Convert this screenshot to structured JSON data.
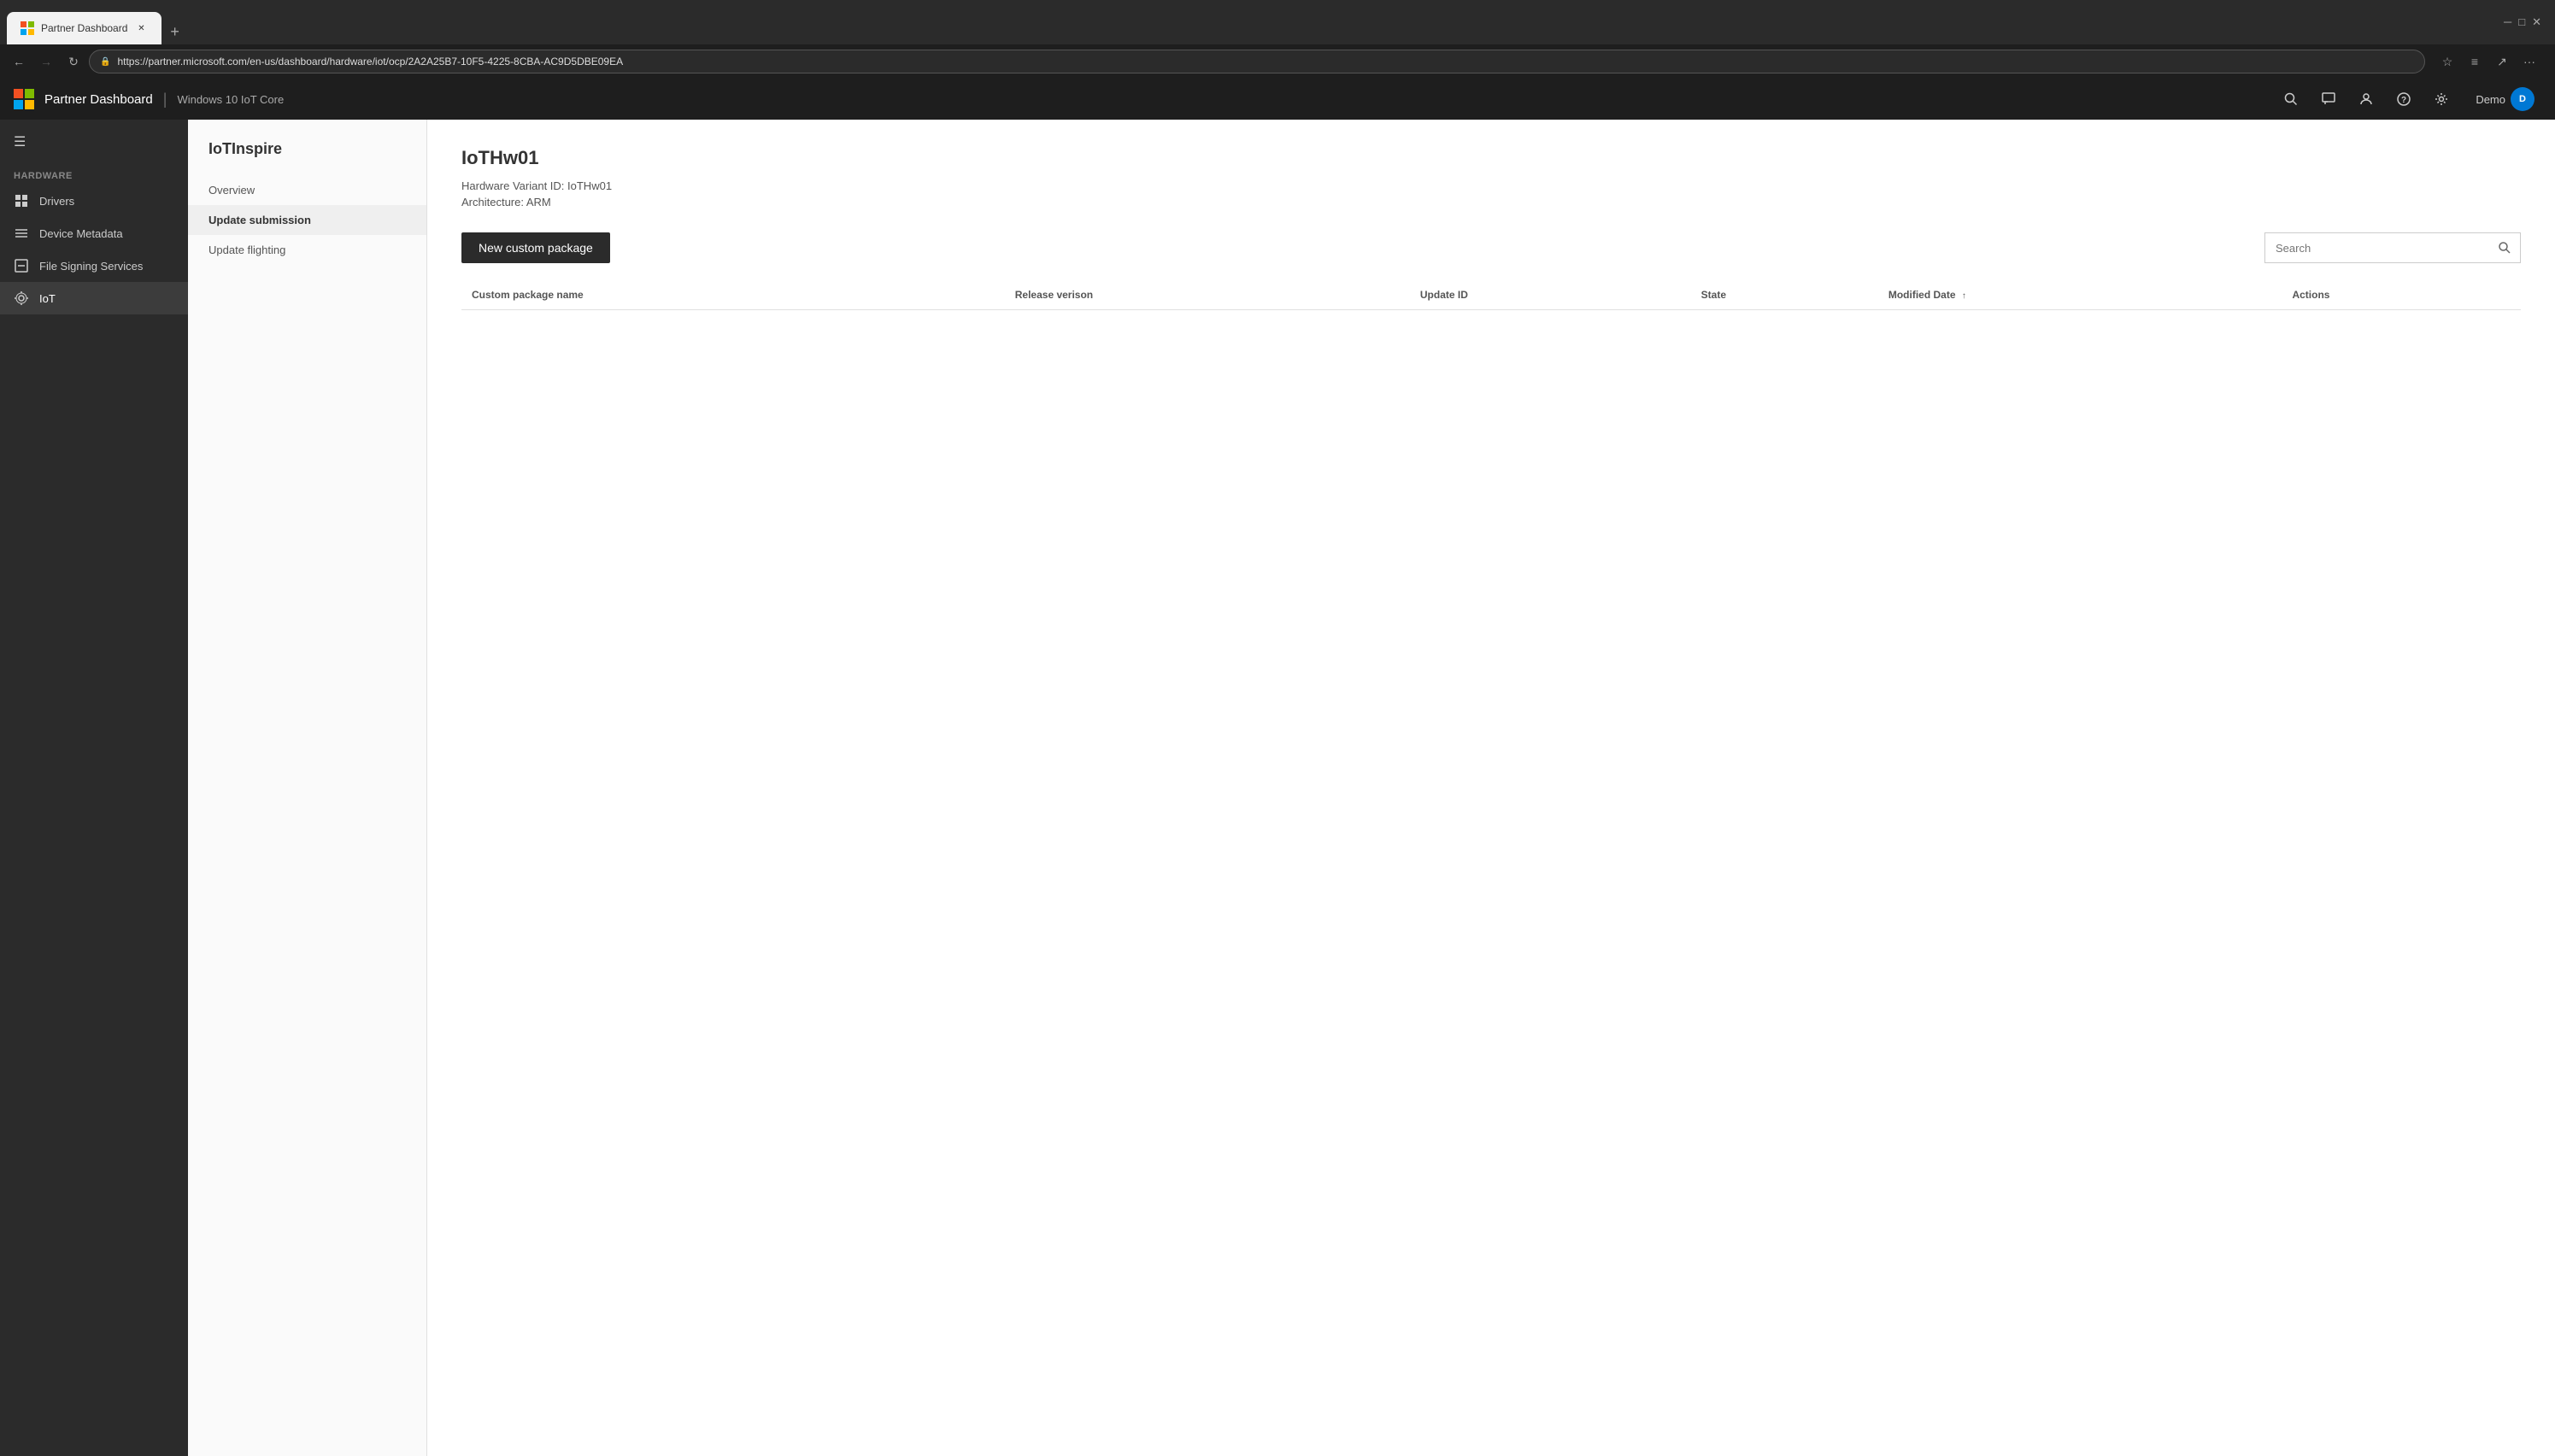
{
  "browser": {
    "tab_title": "Partner Dashboard",
    "tab_favicon": "🟦",
    "url": "https://partner.microsoft.com/en-us/dashboard/hardware/iot/ocp/2A2A25B7-10F5-4225-8CBA-AC9D5DBE09EA",
    "new_tab_icon": "+",
    "nav": {
      "back_disabled": false,
      "forward_disabled": true,
      "reload": "↻"
    }
  },
  "topbar": {
    "title": "Partner Dashboard",
    "divider": "|",
    "subtitle": "Windows 10 IoT Core",
    "icons": {
      "search": "🔍",
      "chat": "💬",
      "people": "👤",
      "help": "?",
      "settings": "⚙"
    },
    "user": {
      "name": "Demo",
      "avatar_initials": "D"
    }
  },
  "sidebar": {
    "section_label": "HARDWARE",
    "items": [
      {
        "id": "drivers",
        "label": "Drivers",
        "icon": "⊞"
      },
      {
        "id": "device-metadata",
        "label": "Device Metadata",
        "icon": "≡"
      },
      {
        "id": "file-signing",
        "label": "File Signing Services",
        "icon": "⊟"
      },
      {
        "id": "iot",
        "label": "IoT",
        "icon": "⚙",
        "active": true
      }
    ]
  },
  "subnav": {
    "title": "IoTInspire",
    "items": [
      {
        "id": "overview",
        "label": "Overview",
        "active": false
      },
      {
        "id": "update-submission",
        "label": "Update submission",
        "active": true
      },
      {
        "id": "update-flighting",
        "label": "Update flighting",
        "active": false
      }
    ]
  },
  "main": {
    "page_title": "IoTHw01",
    "meta": [
      {
        "label": "Hardware Variant ID: IoTHw01"
      },
      {
        "label": "Architecture: ARM"
      }
    ],
    "toolbar": {
      "new_package_btn": "New custom package",
      "search_placeholder": "Search"
    },
    "table": {
      "columns": [
        {
          "id": "name",
          "label": "Custom package name",
          "sortable": false
        },
        {
          "id": "release",
          "label": "Release verison",
          "sortable": false
        },
        {
          "id": "update-id",
          "label": "Update ID",
          "sortable": false
        },
        {
          "id": "state",
          "label": "State",
          "sortable": false
        },
        {
          "id": "modified",
          "label": "Modified Date",
          "sortable": true,
          "sort_direction": "asc"
        },
        {
          "id": "actions",
          "label": "Actions",
          "sortable": false
        }
      ],
      "rows": []
    }
  }
}
